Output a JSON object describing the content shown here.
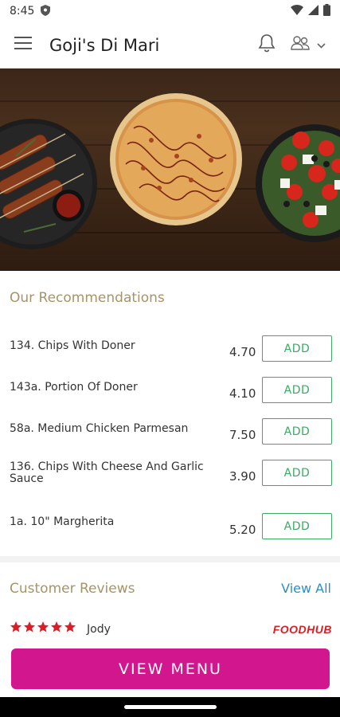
{
  "status_bar": {
    "time": "8:45"
  },
  "app_bar": {
    "title": "Goji's Di Mari"
  },
  "recommendations": {
    "title": "Our Recommendations",
    "add_label": "ADD",
    "items": [
      {
        "name": "134. Chips With Doner",
        "price": "4.70"
      },
      {
        "name": "143a. Portion Of Doner",
        "price": "4.10"
      },
      {
        "name": "58a. Medium Chicken Parmesan",
        "price": "7.50"
      },
      {
        "name": "136. Chips With Cheese And Garlic Sauce",
        "price": "3.90"
      },
      {
        "name": "1a. 10\" Margherita",
        "price": "5.20"
      }
    ]
  },
  "reviews": {
    "title": "Customer Reviews",
    "view_all": "View All",
    "items": [
      {
        "reviewer": "Jody",
        "rating": 5,
        "source": "FOODHUB"
      }
    ]
  },
  "footer": {
    "view_menu": "VIEW MENU"
  },
  "colors": {
    "accent": "#d1168e",
    "add_green": "#3ea866",
    "section_gold": "#a69468",
    "link_blue": "#2c8ec7",
    "star_red": "#d81f26"
  }
}
